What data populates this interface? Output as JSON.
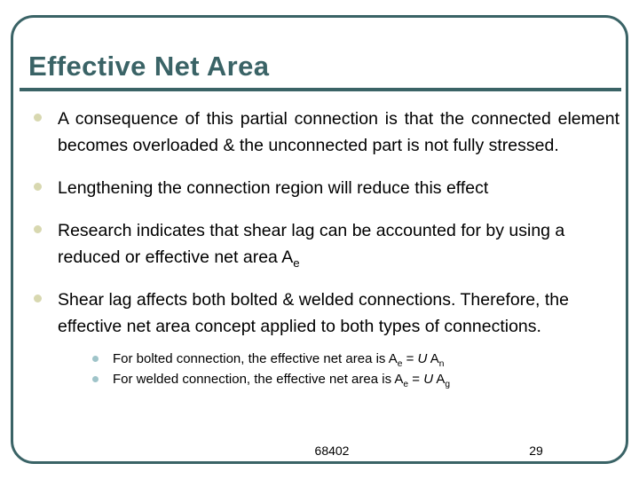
{
  "slide": {
    "title": "Effective Net Area",
    "accent_color": "#3a6366",
    "bullet_color": "#d8d8b0",
    "sub_bullet_color": "#9fc4c9",
    "bullets": [
      {
        "text": "A consequence of this partial connection is that the connected element becomes overloaded & the unconnected part is not fully stressed."
      },
      {
        "text": "Lengthening the connection region will reduce this effect"
      },
      {
        "text_before": "Research indicates that shear lag can be accounted for by using a reduced or effective net area A",
        "sub": "e"
      },
      {
        "text": "Shear lag affects both bolted & welded connections. Therefore, the effective net area concept applied to both types of connections."
      }
    ],
    "sub_bullets": [
      {
        "lead": "For bolted connection, the effective net area is A",
        "sub1": "e",
        "mid": " = ",
        "italic": "U",
        "tail": " A",
        "sub2": "n"
      },
      {
        "lead": "For welded connection, the effective net area is A",
        "sub1": "e",
        "mid": " = ",
        "italic": "U",
        "tail": " A",
        "sub2": "g"
      }
    ],
    "footer": {
      "code": "68402",
      "page": "29"
    }
  }
}
